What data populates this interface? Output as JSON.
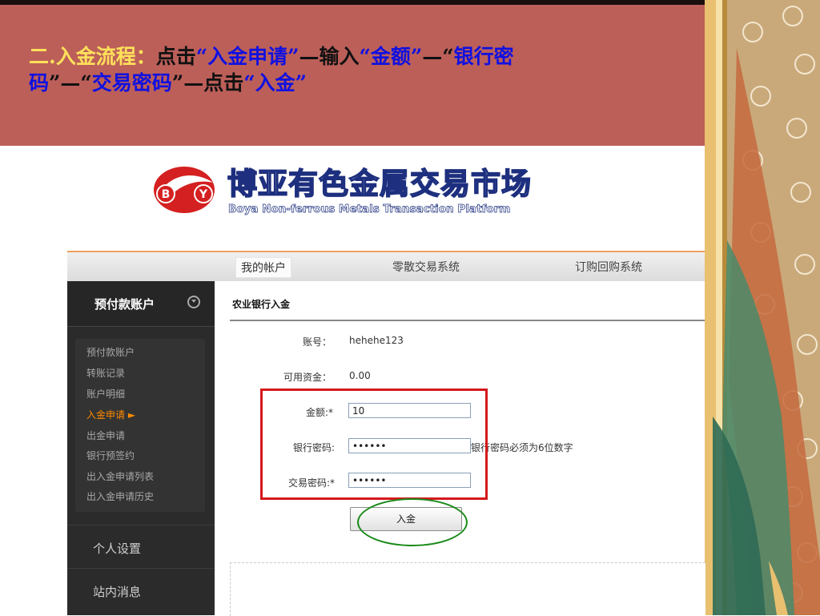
{
  "slide": {
    "title_prefix": "二.入金流程：",
    "title_parts": [
      "点击",
      "“入金申请”",
      "—输入",
      "“金额”",
      "—“",
      "银行密",
      "码",
      "”",
      "—“",
      "交易密码",
      "”",
      "—点击",
      "“入金”"
    ]
  },
  "site": {
    "logo_letters": [
      "B",
      "Y"
    ],
    "brand_cn": "博亚有色金属交易市场",
    "brand_en": "Boya Non-ferrous Metals Transaction Platform"
  },
  "nav": {
    "items": [
      "我的帐户",
      "零散交易系统",
      "订购回购系统"
    ]
  },
  "sidebar": {
    "header": "预付款账户",
    "items": [
      "预付款账户",
      "转账记录",
      "账户明细",
      "入金申请 ►",
      "出金申请",
      "银行预签约",
      "出入金申请列表",
      "出入金申请历史"
    ],
    "sections": [
      "个人设置",
      "站内消息"
    ]
  },
  "form": {
    "title": "农业银行入金",
    "account_label": "账号：",
    "account_value": "hehehe123",
    "funds_label": "可用资金：",
    "funds_value": "0.00",
    "amount_label": "金额:*",
    "amount_value": "10",
    "bank_pwd_label": "银行密码:",
    "bank_pwd_value": "••••••",
    "bank_pwd_hint": "银行密码必须为6位数字",
    "trade_pwd_label": "交易密码:*",
    "trade_pwd_value": "••••••",
    "submit_label": "入金"
  },
  "colors": {
    "slide_band": "#bc5f59",
    "title_highlight": "#ffe15a",
    "title_blue": "#1010e0",
    "annotation_red": "#d4191c",
    "annotation_green": "#1a8a1a",
    "sidebar_active": "#ff8a00"
  }
}
